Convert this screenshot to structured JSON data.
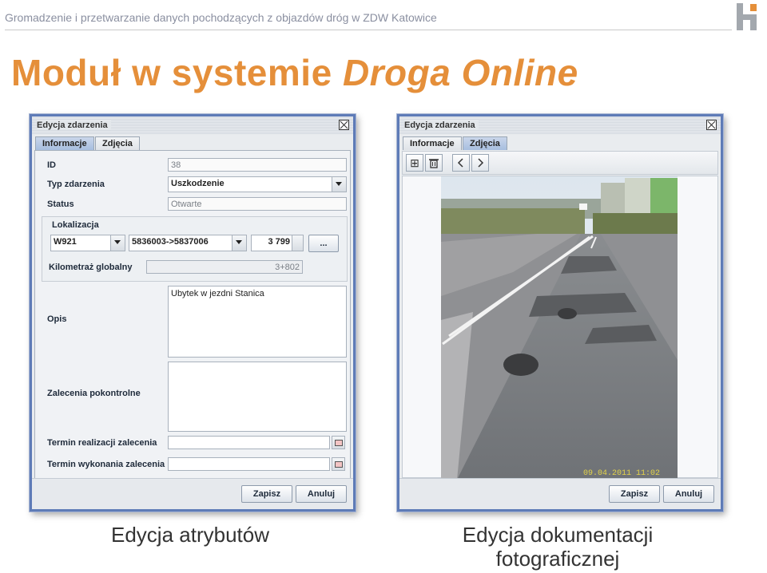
{
  "header": {
    "subtitle": "Gromadzenie i przetwarzanie danych pochodzących z objazdów dróg w ZDW Katowice"
  },
  "slide": {
    "title_plain": "Moduł w systemie ",
    "title_italic": "Droga Online"
  },
  "left_window": {
    "title": "Edycja zdarzenia",
    "tabs": [
      "Informacje",
      "Zdjęcia"
    ],
    "fields": {
      "id_label": "ID",
      "id_value": "38",
      "type_label": "Typ zdarzenia",
      "type_value": "Uszkodzenie",
      "status_label": "Status",
      "status_value": "Otwarte",
      "loc_label": "Lokalizacja",
      "road_value": "W921",
      "section_value": "5836003->5837006",
      "km_value": "3 799",
      "more_btn": "...",
      "global_km_label": "Kilometraż globalny",
      "global_km_value": "3+802",
      "desc_label": "Opis",
      "desc_value": "Ubytek w jezdni Stanica",
      "rec_label": "Zalecenia pokontrolne",
      "rec_value": "",
      "term_real_label": "Termin realizacji zalecenia",
      "term_done_label": "Termin wykonania zalecenia"
    },
    "save_label": "Zapisz",
    "cancel_label": "Anuluj"
  },
  "right_window": {
    "title": "Edycja zdarzenia",
    "tabs": [
      "Informacje",
      "Zdjęcia"
    ],
    "photo_timestamp": "09.04.2011 11:02",
    "save_label": "Zapisz",
    "cancel_label": "Anuluj"
  },
  "captions": {
    "left": "Edycja atrybutów",
    "right_line1": "Edycja dokumentacji",
    "right_line2": "fotograficznej"
  },
  "colors": {
    "title": "#e58f3a",
    "window_border": "#5e7bb7"
  },
  "icons": [
    "logo-icon",
    "close-icon",
    "add-icon",
    "trash-icon",
    "prev-icon",
    "next-icon",
    "calendar-icon",
    "chevron-down-icon"
  ]
}
